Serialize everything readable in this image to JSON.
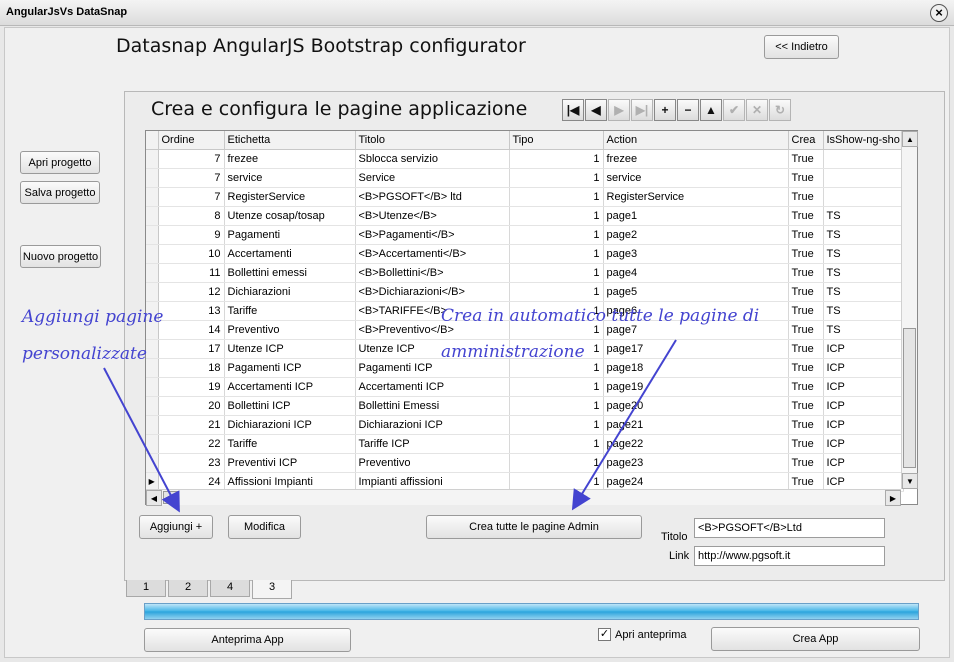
{
  "window": {
    "title": "AngularJsVs DataSnap",
    "close_symbol": "×"
  },
  "header": {
    "title": "Datasnap AngularJS Bootstrap configurator",
    "back_label": "<< Indietro"
  },
  "left_buttons": {
    "open_label": "Apri progetto",
    "save_label": "Salva progetto",
    "new_label": "Nuovo progetto"
  },
  "panel": {
    "title": "Crea e configura le pagine applicazione"
  },
  "navigator": {
    "buttons": [
      {
        "name": "first-record-button",
        "symbol": "|◀",
        "enabled": true
      },
      {
        "name": "prior-record-button",
        "symbol": "◀",
        "enabled": true
      },
      {
        "name": "next-record-button",
        "symbol": "▶",
        "enabled": false
      },
      {
        "name": "last-record-button",
        "symbol": "▶|",
        "enabled": false
      },
      {
        "name": "insert-record-button",
        "symbol": "+",
        "enabled": true
      },
      {
        "name": "delete-record-button",
        "symbol": "−",
        "enabled": true
      },
      {
        "name": "edit-record-button",
        "symbol": "▲",
        "enabled": true
      },
      {
        "name": "post-record-button",
        "symbol": "✔",
        "enabled": false
      },
      {
        "name": "cancel-record-button",
        "symbol": "✕",
        "enabled": false
      },
      {
        "name": "refresh-record-button",
        "symbol": "↻",
        "enabled": false
      }
    ]
  },
  "grid": {
    "columns": [
      "Ordine",
      "Etichetta",
      "Titolo",
      "Tipo",
      "Action",
      "Crea",
      "IsShow-ng-sho"
    ],
    "current_row_marker": "▶",
    "rows": [
      [
        "7",
        "frezee",
        "Sblocca servizio",
        "1",
        "frezee",
        "True",
        ""
      ],
      [
        "7",
        "service",
        "Service",
        "1",
        "service",
        "True",
        ""
      ],
      [
        "7",
        "RegisterService",
        "<B>PGSOFT</B> ltd",
        "1",
        "RegisterService",
        "True",
        ""
      ],
      [
        "8",
        "Utenze cosap/tosap",
        "<B>Utenze</B>",
        "1",
        "page1",
        "True",
        "TS"
      ],
      [
        "9",
        "Pagamenti",
        "<B>Pagamenti</B>",
        "1",
        "page2",
        "True",
        "TS"
      ],
      [
        "10",
        "Accertamenti",
        "<B>Accertamenti</B>",
        "1",
        "page3",
        "True",
        "TS"
      ],
      [
        "11",
        "Bollettini emessi",
        "<B>Bollettini</B>",
        "1",
        "page4",
        "True",
        "TS"
      ],
      [
        "12",
        "Dichiarazioni",
        "<B>Dichiarazioni</B>",
        "1",
        "page5",
        "True",
        "TS"
      ],
      [
        "13",
        "Tariffe",
        "<B>TARIFFE</B>",
        "1",
        "page6",
        "True",
        "TS"
      ],
      [
        "14",
        "Preventivo",
        "<B>Preventivo</B>",
        "1",
        "page7",
        "True",
        "TS"
      ],
      [
        "17",
        "Utenze ICP",
        "Utenze ICP",
        "1",
        "page17",
        "True",
        "ICP"
      ],
      [
        "18",
        "Pagamenti ICP",
        "Pagamenti ICP",
        "1",
        "page18",
        "True",
        "ICP"
      ],
      [
        "19",
        "Accertamenti ICP",
        "Accertamenti ICP",
        "1",
        "page19",
        "True",
        "ICP"
      ],
      [
        "20",
        "Bollettini ICP",
        "Bollettini Emessi",
        "1",
        "page20",
        "True",
        "ICP"
      ],
      [
        "21",
        "Dichiarazioni ICP",
        "Dichiarazioni ICP",
        "1",
        "page21",
        "True",
        "ICP"
      ],
      [
        "22",
        "Tariffe",
        "Tariffe ICP",
        "1",
        "page22",
        "True",
        "ICP"
      ],
      [
        "23",
        "Preventivi ICP",
        "Preventivo",
        "1",
        "page23",
        "True",
        "ICP"
      ],
      [
        "24",
        "Affissioni Impianti",
        "Impianti affissioni",
        "1",
        "page24",
        "True",
        "ICP"
      ]
    ]
  },
  "actions": {
    "add_label": "Aggiungi +",
    "edit_label": "Modifica",
    "create_all_label": "Crea tutte le pagine Admin"
  },
  "fields": {
    "titolo_label": "Titolo",
    "titolo_value": "<B>PGSOFT</B>Ltd",
    "link_label": "Link",
    "link_value": "http://www.pgsoft.it"
  },
  "tabs": [
    "1",
    "2",
    "4",
    "3"
  ],
  "active_tab": "3",
  "progress": {
    "fraction": 1.0
  },
  "footer": {
    "preview_label": "Anteprima App",
    "open_preview_label": "Apri anteprima",
    "open_preview_checked": true,
    "create_label": "Crea App"
  },
  "annotations": {
    "left_line1": "Aggiungi pagine",
    "left_line2": "personalizzate",
    "center_line1": "Crea in automatico tutte le pagine di",
    "center_line2": "amministrazione"
  },
  "colors": {
    "annotation": "#4444d0",
    "progress": "#29a3dc"
  }
}
